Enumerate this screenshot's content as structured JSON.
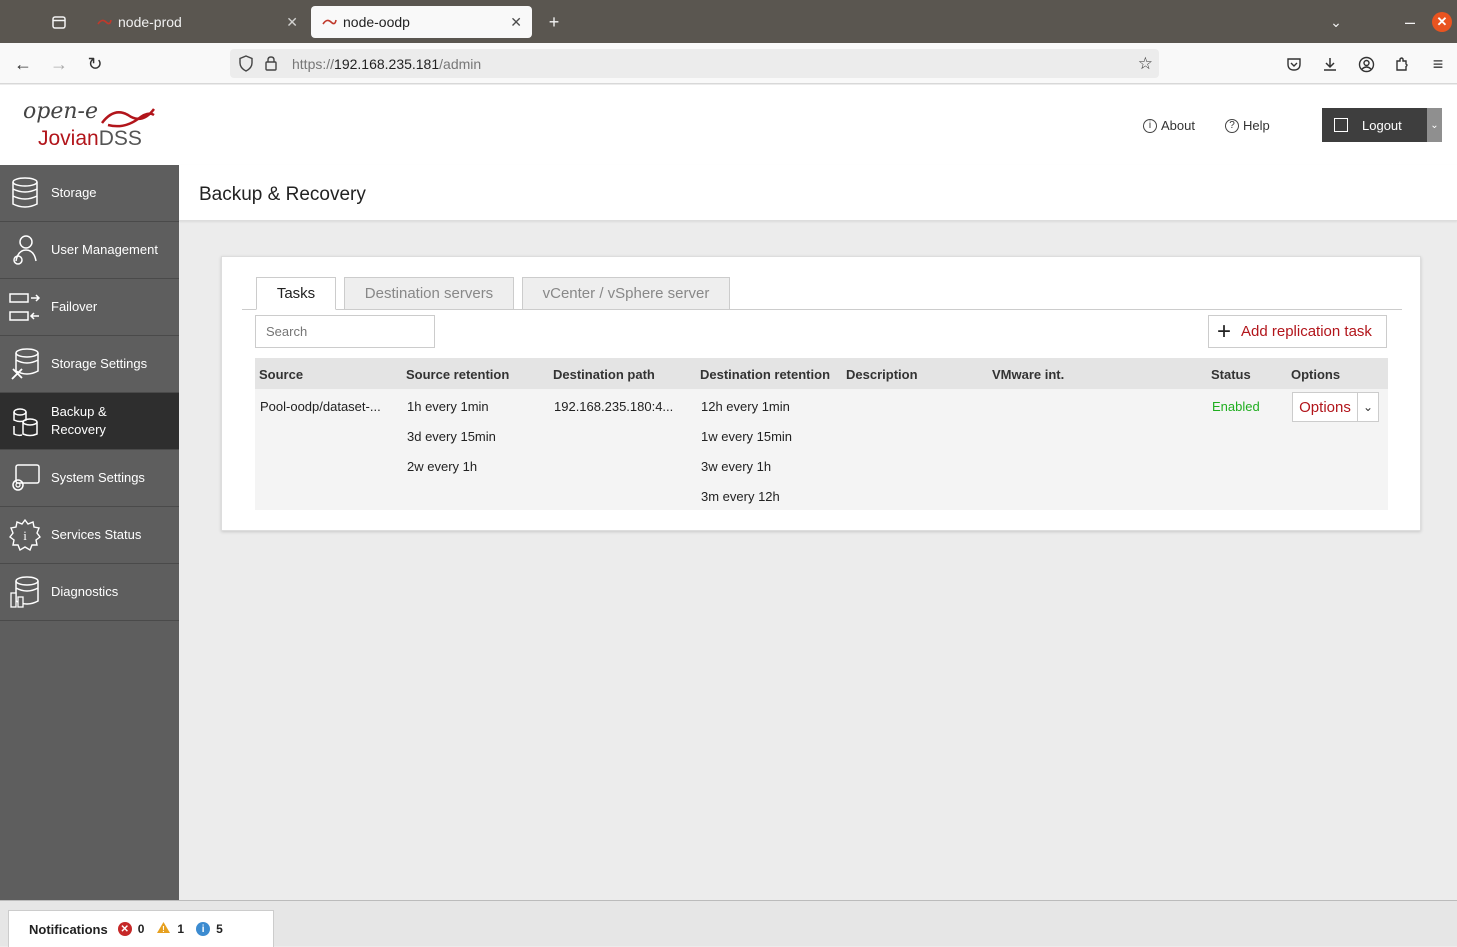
{
  "browser": {
    "tabs": [
      {
        "title": "node-prod",
        "active": false
      },
      {
        "title": "node-oodp",
        "active": true
      }
    ],
    "url_prefix": "https://",
    "url_host": "192.168.235.181",
    "url_path": "/admin"
  },
  "header": {
    "logo_line1": "open-e",
    "logo_jovian": "Jovian",
    "logo_dss": "DSS",
    "about": "About",
    "help": "Help",
    "logout": "Logout"
  },
  "sidebar": {
    "items": [
      {
        "label": "Storage",
        "icon": "storage-icon"
      },
      {
        "label": "User Management",
        "icon": "user-management-icon"
      },
      {
        "label": "Failover",
        "icon": "failover-icon"
      },
      {
        "label": "Storage Settings",
        "icon": "storage-settings-icon"
      },
      {
        "label": "Backup &",
        "label2": "Recovery",
        "icon": "backup-recovery-icon"
      },
      {
        "label": "System Settings",
        "icon": "system-settings-icon"
      },
      {
        "label": "Services Status",
        "icon": "services-status-icon"
      },
      {
        "label": "Diagnostics",
        "icon": "diagnostics-icon"
      }
    ]
  },
  "page": {
    "title": "Backup & Recovery",
    "tabs": [
      "Tasks",
      "Destination servers",
      "vCenter / vSphere server"
    ],
    "search_placeholder": "Search",
    "add_button": "Add replication task"
  },
  "table": {
    "columns": [
      "Source",
      "Source retention",
      "Destination path",
      "Destination retention",
      "Description",
      "VMware int.",
      "Status",
      "Options"
    ],
    "rows": [
      {
        "source": "Pool-oodp/dataset-...",
        "source_retention": [
          "1h every 1min",
          "3d every 15min",
          "2w every 1h"
        ],
        "destination_path": "192.168.235.180:4...",
        "destination_retention": [
          "12h every 1min",
          "1w every 15min",
          "3w every 1h",
          "3m every 12h"
        ],
        "description": "",
        "vmware": "",
        "status": "Enabled",
        "options": "Options"
      }
    ]
  },
  "notifications": {
    "label": "Notifications",
    "errors": "0",
    "warnings": "1",
    "info": "5"
  },
  "colors": {
    "accent": "#b2151b",
    "enabled": "#1fae1f",
    "sidebar": "#5e5e5e",
    "sidebar_active": "#2e2e2e"
  }
}
